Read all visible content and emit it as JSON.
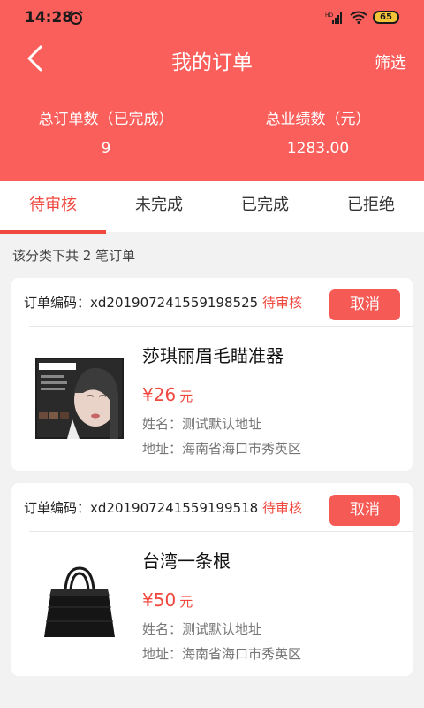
{
  "status_bar": {
    "time": "14:28",
    "battery": "65"
  },
  "header": {
    "title": "我的订单",
    "filter": "筛选"
  },
  "stats": [
    {
      "label": "总订单数（已完成）",
      "value": "9"
    },
    {
      "label": "总业绩数（元）",
      "value": "1283.00"
    }
  ],
  "tabs": [
    "待审核",
    "未完成",
    "已完成",
    "已拒绝"
  ],
  "summary": "该分类下共 2 笔订单",
  "orders": [
    {
      "number_label": "订单编码：",
      "number": "xd20190724155919852​5",
      "status": "待审核",
      "cancel": "取消",
      "product": "莎琪丽眉毛瞄准器",
      "price": "¥26",
      "unit": "元",
      "name_line": "姓名：测试默认地址",
      "address_line": "地址：海南省海口市秀英区"
    },
    {
      "number_label": "订单编码：",
      "number": "xd2019072415591995​18",
      "status": "待审核",
      "cancel": "取消",
      "product": "台湾一条根",
      "price": "¥50",
      "unit": "元",
      "name_line": "姓名：测试默认地址",
      "address_line": "地址：海南省海口市秀英区"
    }
  ]
}
